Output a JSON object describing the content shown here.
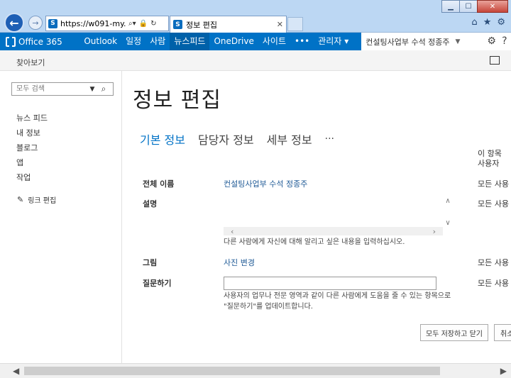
{
  "browser": {
    "url": "https://w091-my.s...",
    "tab_title": "정보 편집"
  },
  "suite": {
    "brand": "Office 365",
    "links": [
      "Outlook",
      "일정",
      "사람",
      "뉴스피드",
      "OneDrive",
      "사이트",
      "•••",
      "관리자"
    ],
    "active_link": "뉴스피드",
    "user": "컨설팅사업부 수석 정종주"
  },
  "ribbon": {
    "browse": "찾아보기"
  },
  "leftnav": {
    "search_placeholder": "모두 검색",
    "items": [
      "뉴스 피드",
      "내 정보",
      "블로그",
      "앱",
      "작업"
    ],
    "edit_links": "링크 편집"
  },
  "main": {
    "title": "정보 편집",
    "tabs": [
      "기본 정보",
      "담당자 정보",
      "세부 정보",
      "..."
    ],
    "column_header": [
      "이 항목",
      "사용자"
    ],
    "rows": {
      "name": {
        "label": "전체 이름",
        "value": "컨설팅사업부 수석 정종주",
        "privacy": "모든 사용"
      },
      "about": {
        "label": "설명",
        "hint": "다른 사람에게 자신에 대해 알리고 싶은 내용을 입력하십시오.",
        "privacy": "모든 사용"
      },
      "picture": {
        "label": "그림",
        "value": "사진 변경",
        "privacy": "모든 사용"
      },
      "ask": {
        "label": "질문하기",
        "value": "",
        "hint_line1": "사용자의 업무나 전문 영역과 같이 다른 사람에게 도움을 줄 수 있는 항목으로",
        "hint_line2": "\"질문하기\"를 업데이트합니다.",
        "privacy": "모든 사용"
      }
    },
    "save_all": "모두 저장하고 닫기",
    "cancel": "취소"
  }
}
